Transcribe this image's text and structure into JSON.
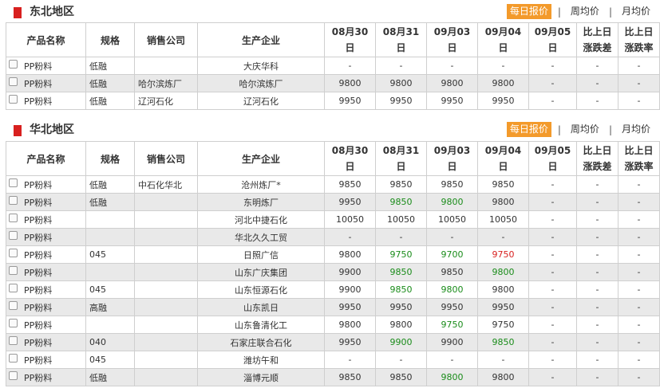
{
  "headers": [
    "产品名称",
    "规格",
    "销售公司",
    "生产企业",
    "08月30日",
    "08月31日",
    "09月03日",
    "09月04日",
    "09月05日",
    "比上日涨跌差",
    "比上日涨跌率"
  ],
  "tabs": {
    "daily": "每日报价",
    "weekly": "周均价",
    "monthly": "月均价",
    "sep": "|"
  },
  "sections": [
    {
      "title": "东北地区",
      "rows": [
        {
          "product": "PP粉料",
          "spec": "低融",
          "seller": "",
          "producer": "大庆华科",
          "v": [
            "-",
            "-",
            "-",
            "-",
            "-",
            "-",
            "-"
          ]
        },
        {
          "product": "PP粉料",
          "spec": "低融",
          "seller": "哈尔滨炼厂",
          "producer": "哈尔滨炼厂",
          "v": [
            "9800",
            "9800",
            "9800",
            "9800",
            "-",
            "-",
            "-"
          ]
        },
        {
          "product": "PP粉料",
          "spec": "低融",
          "seller": "辽河石化",
          "producer": "辽河石化",
          "v": [
            "9950",
            "9950",
            "9950",
            "9950",
            "-",
            "-",
            "-"
          ]
        }
      ]
    },
    {
      "title": "华北地区",
      "rows": [
        {
          "product": "PP粉料",
          "spec": "低融",
          "seller": "中石化华北",
          "producer": "沧州炼厂*",
          "v": [
            "9850",
            "9850",
            "9850",
            "9850",
            "-",
            "-",
            "-"
          ]
        },
        {
          "product": "PP粉料",
          "spec": "低融",
          "seller": "",
          "producer": "东明炼厂",
          "v": [
            "9950",
            "9850",
            "9800",
            "9800",
            "-",
            "-",
            "-"
          ],
          "c": [
            "",
            "g",
            "g",
            "",
            "",
            "",
            ""
          ]
        },
        {
          "product": "PP粉料",
          "spec": "",
          "seller": "",
          "producer": "河北中捷石化",
          "v": [
            "10050",
            "10050",
            "10050",
            "10050",
            "-",
            "-",
            "-"
          ]
        },
        {
          "product": "PP粉料",
          "spec": "",
          "seller": "",
          "producer": "华北久久工贸",
          "v": [
            "-",
            "-",
            "-",
            "-",
            "-",
            "-",
            "-"
          ]
        },
        {
          "product": "PP粉料",
          "spec": "045",
          "seller": "",
          "producer": "日照广信",
          "v": [
            "9800",
            "9750",
            "9700",
            "9750",
            "-",
            "-",
            "-"
          ],
          "c": [
            "",
            "g",
            "g",
            "r",
            "",
            "",
            ""
          ]
        },
        {
          "product": "PP粉料",
          "spec": "",
          "seller": "",
          "producer": "山东广庆集团",
          "v": [
            "9900",
            "9850",
            "9850",
            "9800",
            "-",
            "-",
            "-"
          ],
          "c": [
            "",
            "g",
            "",
            "g",
            "",
            "",
            ""
          ]
        },
        {
          "product": "PP粉料",
          "spec": "045",
          "seller": "",
          "producer": "山东恒源石化",
          "v": [
            "9900",
            "9850",
            "9800",
            "9800",
            "-",
            "-",
            "-"
          ],
          "c": [
            "",
            "g",
            "g",
            "",
            "",
            "",
            ""
          ]
        },
        {
          "product": "PP粉料",
          "spec": "高融",
          "seller": "",
          "producer": "山东凯日",
          "v": [
            "9950",
            "9950",
            "9950",
            "9950",
            "-",
            "-",
            "-"
          ]
        },
        {
          "product": "PP粉料",
          "spec": "",
          "seller": "",
          "producer": "山东鲁清化工",
          "v": [
            "9800",
            "9800",
            "9750",
            "9750",
            "-",
            "-",
            "-"
          ],
          "c": [
            "",
            "",
            "g",
            "",
            "",
            "",
            ""
          ]
        },
        {
          "product": "PP粉料",
          "spec": "040",
          "seller": "",
          "producer": "石家庄联合石化",
          "v": [
            "9950",
            "9900",
            "9900",
            "9850",
            "-",
            "-",
            "-"
          ],
          "c": [
            "",
            "g",
            "",
            "g",
            "",
            "",
            ""
          ]
        },
        {
          "product": "PP粉料",
          "spec": "045",
          "seller": "",
          "producer": "潍坊午和",
          "v": [
            "-",
            "-",
            "-",
            "-",
            "-",
            "-",
            "-"
          ]
        },
        {
          "product": "PP粉料",
          "spec": "低融",
          "seller": "",
          "producer": "淄博元顺",
          "v": [
            "9850",
            "9850",
            "9800",
            "9800",
            "-",
            "-",
            "-"
          ],
          "c": [
            "",
            "",
            "g",
            "",
            "",
            "",
            ""
          ]
        }
      ]
    }
  ]
}
